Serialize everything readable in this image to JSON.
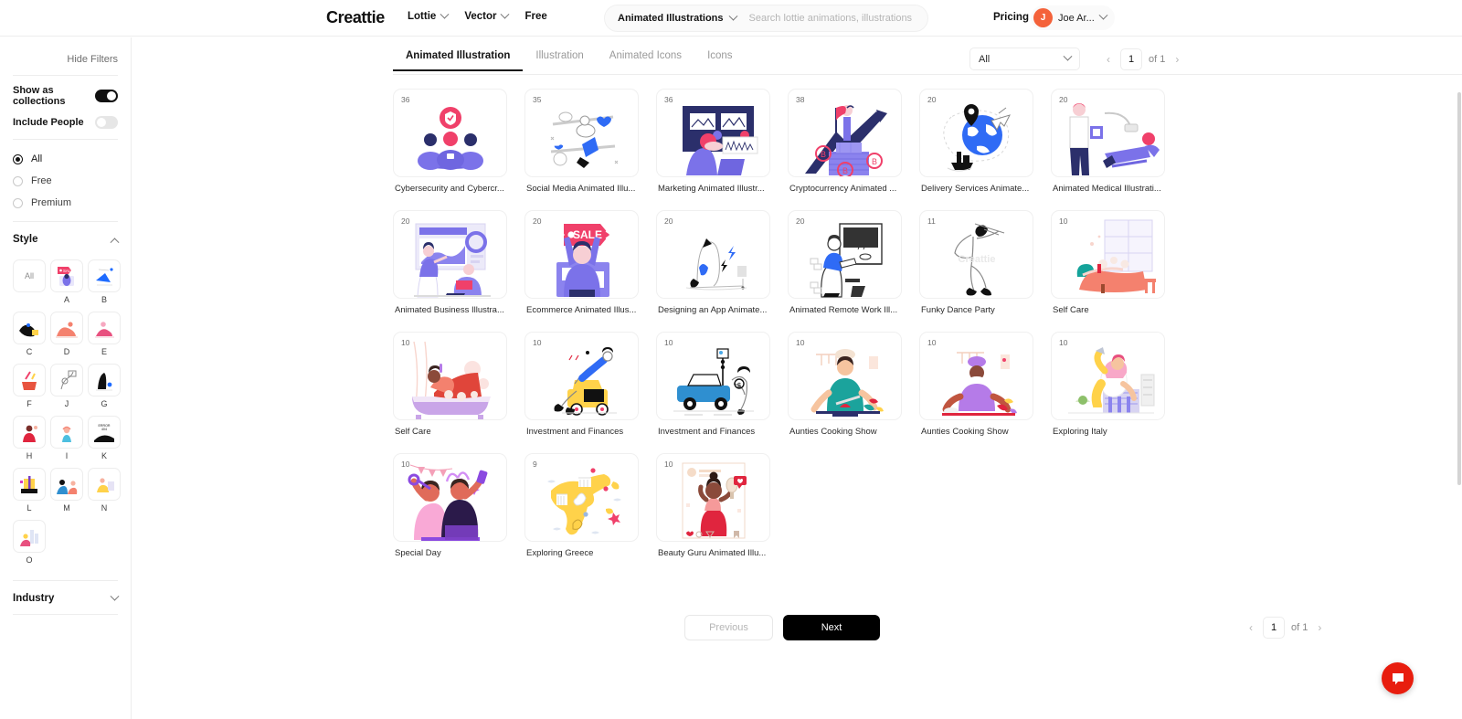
{
  "header": {
    "brand": "Creattie",
    "nav": [
      {
        "label": "Lottie",
        "has_caret": true,
        "icon": "chevron-down-icon"
      },
      {
        "label": "Vector",
        "has_caret": true,
        "icon": "chevron-down-icon"
      },
      {
        "label": "Free",
        "has_caret": false,
        "icon": ""
      }
    ],
    "search": {
      "category": "Animated Illustrations",
      "category_icon": "chevron-down-icon",
      "placeholder": "Search lottie animations, illustrations or icons",
      "value": ""
    },
    "pricing_label": "Pricing",
    "account": {
      "initial": "J",
      "name": "Joe Ar...",
      "icon": "chevron-down-icon"
    }
  },
  "sidebar": {
    "hide_filters_label": "Hide Filters",
    "toggles": [
      {
        "label": "Show as collections",
        "state": "on"
      },
      {
        "label": "Include People",
        "state": "off"
      }
    ],
    "plan_options": [
      {
        "label": "All",
        "selected": true
      },
      {
        "label": "Free",
        "selected": false
      },
      {
        "label": "Premium",
        "selected": false
      }
    ],
    "style_section": {
      "title": "Style",
      "expanded": true,
      "chevron_icon": "chevron-up-icon",
      "all_label": "All",
      "items": [
        {
          "letter": "A"
        },
        {
          "letter": "B"
        },
        {
          "letter": "C"
        },
        {
          "letter": "D"
        },
        {
          "letter": "E"
        },
        {
          "letter": "F"
        },
        {
          "letter": "J"
        },
        {
          "letter": "G"
        },
        {
          "letter": "H"
        },
        {
          "letter": "I"
        },
        {
          "letter": "K"
        },
        {
          "letter": "L"
        },
        {
          "letter": "M"
        },
        {
          "letter": "N"
        },
        {
          "letter": "O"
        }
      ]
    },
    "industry_section": {
      "title": "Industry",
      "expanded": false,
      "chevron_icon": "chevron-down-icon"
    }
  },
  "main": {
    "tabs": [
      {
        "label": "Animated Illustration",
        "active": true
      },
      {
        "label": "Illustration",
        "active": false
      },
      {
        "label": "Animated Icons",
        "active": false
      },
      {
        "label": "Icons",
        "active": false
      }
    ],
    "filter_select": {
      "value": "All",
      "icon": "chevron-down-icon"
    },
    "pager_top": {
      "prev_icon": "chevron-left-icon",
      "page": "1",
      "of_label": "of 1",
      "next_icon": "chevron-right-icon"
    },
    "cards": [
      {
        "count": "36",
        "title": "Cybersecurity and Cybercr...",
        "art": "cybersecurity"
      },
      {
        "count": "35",
        "title": "Social Media Animated Illu...",
        "art": "socialmedia"
      },
      {
        "count": "36",
        "title": "Marketing Animated Illustr...",
        "art": "marketing"
      },
      {
        "count": "38",
        "title": "Cryptocurrency Animated ...",
        "art": "crypto"
      },
      {
        "count": "20",
        "title": "Delivery Services Animate...",
        "art": "delivery"
      },
      {
        "count": "20",
        "title": "Animated Medical Illustrati...",
        "art": "medical"
      },
      {
        "count": "20",
        "title": "Animated Business Illustra...",
        "art": "business"
      },
      {
        "count": "20",
        "title": "Ecommerce Animated Illus...",
        "art": "ecommerce"
      },
      {
        "count": "20",
        "title": "Designing an App Animate...",
        "art": "designapp"
      },
      {
        "count": "20",
        "title": "Animated Remote Work Ill...",
        "art": "remotework"
      },
      {
        "count": "11",
        "title": "Funky Dance Party",
        "art": "dance"
      },
      {
        "count": "10",
        "title": "Self Care",
        "art": "selfcare1"
      },
      {
        "count": "10",
        "title": "Self Care",
        "art": "selfcare2"
      },
      {
        "count": "10",
        "title": "Investment and Finances",
        "art": "invest1"
      },
      {
        "count": "10",
        "title": "Investment and Finances",
        "art": "invest2"
      },
      {
        "count": "10",
        "title": "Aunties Cooking Show",
        "art": "cooking1"
      },
      {
        "count": "10",
        "title": "Aunties Cooking Show",
        "art": "cooking2"
      },
      {
        "count": "10",
        "title": "Exploring Italy",
        "art": "italy"
      },
      {
        "count": "10",
        "title": "Special Day",
        "art": "specialday"
      },
      {
        "count": "9",
        "title": "Exploring Greece",
        "art": "greece"
      },
      {
        "count": "10",
        "title": "Beauty Guru Animated Illu...",
        "art": "beauty"
      }
    ],
    "bottom_pager": {
      "previous_label": "Previous",
      "next_label": "Next",
      "prev_icon": "chevron-left-icon",
      "page": "1",
      "of_label": "of 1",
      "next_icon": "chevron-right-icon"
    }
  },
  "chat": {
    "icon": "chat-bubble-icon",
    "color": "#e81d0e"
  },
  "colors": {
    "accent_dark": "#141414",
    "avatar": "#f4623a",
    "chat": "#e81d0e",
    "purple": "#7b72e9",
    "navy": "#2b2f6b",
    "pink": "#f0406a"
  }
}
